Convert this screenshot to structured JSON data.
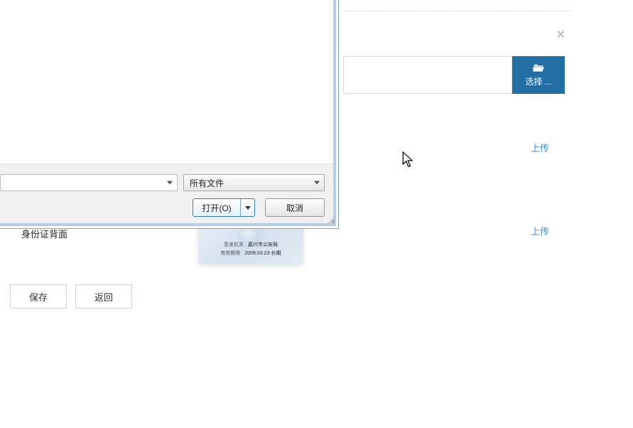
{
  "modal": {
    "close_label": "×"
  },
  "form": {
    "select_button_label": "选择 ...",
    "upload_link_label": "上传",
    "id_back_label": "身份证背面",
    "save_label": "保存",
    "back_label": "返回"
  },
  "id_card": {
    "issuer_key": "签发机关",
    "issuer_value": "嘉兴市公安局",
    "validity_key": "有效期限",
    "validity_value": "2009.03.23-长期"
  },
  "file_dialog": {
    "filter_label": "所有文件",
    "open_label": "打开(O)",
    "cancel_label": "取消",
    "filename_value": ""
  }
}
